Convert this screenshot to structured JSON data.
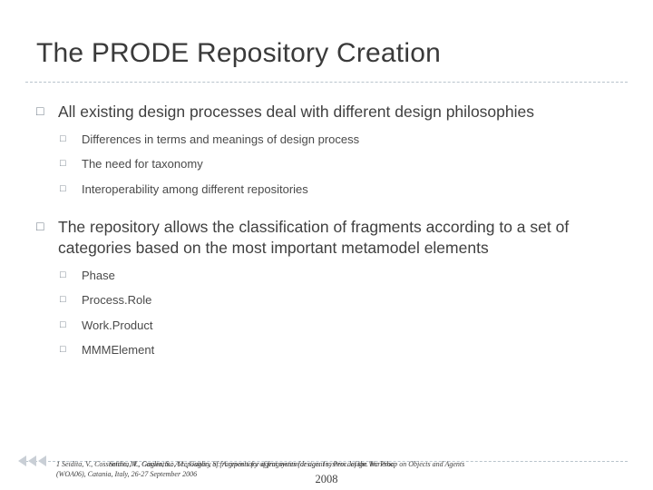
{
  "slide": {
    "title": "The PRODE Repository Creation",
    "bullets": [
      {
        "level1": "All existing design processes deal with different design philosophies",
        "marker": "□",
        "sub": [
          {
            "marker": "□",
            "text": "Differences in  terms  and meanings of design process"
          },
          {
            "marker": "□",
            "text": "The need for taxonomy"
          },
          {
            "marker": "□",
            "text": "Interoperability among different repositories"
          }
        ]
      },
      {
        "level1": "The repository allows the classification of fragments according to a set of categories based on the most important metamodel elements",
        "marker": "□",
        "sub": [
          {
            "marker": "□",
            "text": "Phase"
          },
          {
            "marker": "□",
            "text": "Process.Role"
          },
          {
            "marker": "□",
            "text": "Work.Product"
          },
          {
            "marker": "□",
            "text": "MMMElement"
          }
        ]
      }
    ]
  },
  "footer": {
    "citation_line1": "1 Seidita, V., Cossentino, M., Gaglio, S.: A repository of fragments for agent system design. In: Proc. of the Workshop on Objects and Agents",
    "citation_line2": "(WOA06), Catania, Italy, 26-27 September 2006",
    "citation_overlap": "Seidita, V., Cossentino, M., Gaglio, S.: A repository of fragments for agent system design. In: Proc.",
    "year": "2008"
  }
}
